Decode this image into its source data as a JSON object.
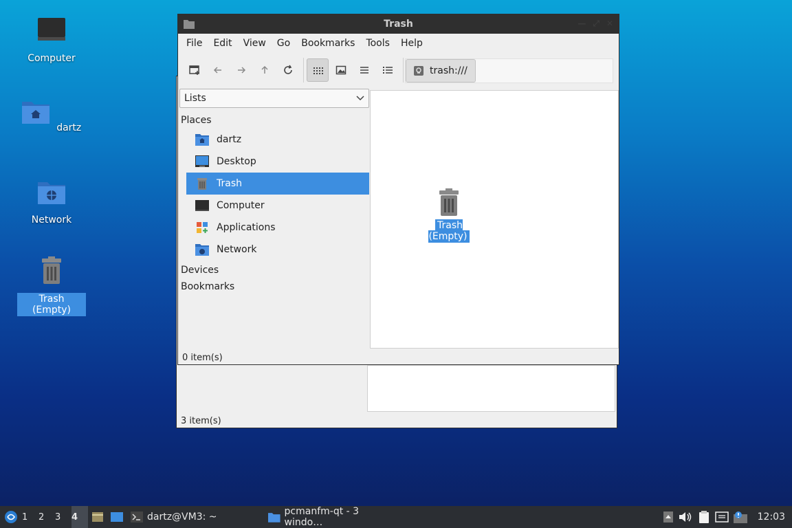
{
  "desktop": {
    "icons": [
      {
        "label": "Computer"
      },
      {
        "label": "dartz"
      },
      {
        "label": "Network"
      },
      {
        "label": "Trash (Empty)"
      }
    ]
  },
  "back_window": {
    "status": "3 item(s)"
  },
  "window": {
    "title": "Trash",
    "menus": [
      "File",
      "Edit",
      "View",
      "Go",
      "Bookmarks",
      "Tools",
      "Help"
    ],
    "path": "trash:///",
    "sidebar_mode": "Lists",
    "sections": {
      "places": "Places",
      "devices": "Devices",
      "bookmarks": "Bookmarks"
    },
    "places": [
      {
        "label": "dartz"
      },
      {
        "label": "Desktop"
      },
      {
        "label": "Trash"
      },
      {
        "label": "Computer"
      },
      {
        "label": "Applications"
      },
      {
        "label": "Network"
      }
    ],
    "content_item": "Trash (Empty)",
    "status": "0 item(s)"
  },
  "taskbar": {
    "workspaces": [
      "1",
      "2",
      "3",
      "4"
    ],
    "tasks": [
      {
        "label": "dartz@VM3: ~"
      },
      {
        "label": "pcmanfm-qt - 3 windo…"
      }
    ],
    "clock": "12:03"
  },
  "colors": {
    "accent": "#3d8ee0",
    "titlebar": "#2f2f2f",
    "taskbar": "#2b2e33"
  }
}
